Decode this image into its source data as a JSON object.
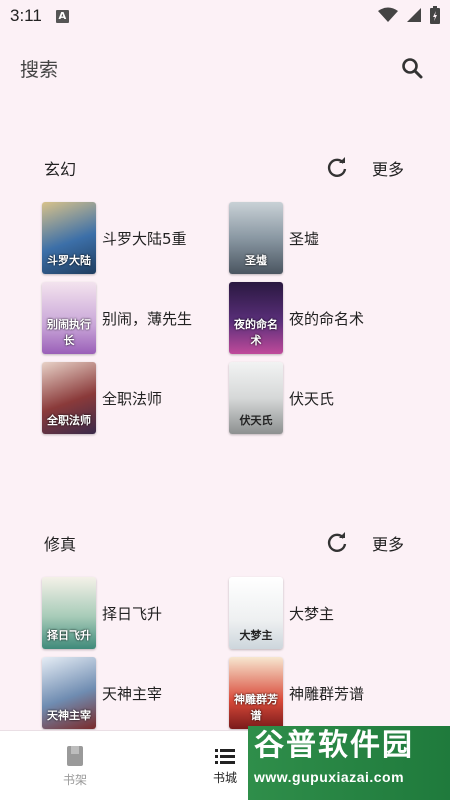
{
  "status_bar": {
    "time": "3:11",
    "notification_glyph": "A",
    "icons": [
      "wifi-icon",
      "signal-icon",
      "battery-icon"
    ]
  },
  "search": {
    "placeholder": "搜索",
    "icon": "search-icon"
  },
  "sections": [
    {
      "title": "玄幻",
      "more_label": "更多",
      "refresh_icon": "refresh-icon",
      "books": [
        {
          "title": "斗罗大陆5重",
          "cover_text": "斗罗大陆",
          "cover_color": "#3c6fa8"
        },
        {
          "title": "圣墟",
          "cover_text": "圣墟",
          "cover_color": "#8a98a3"
        },
        {
          "title": "别闹，薄先生",
          "cover_text": "别闹执行长",
          "cover_color": "#c9a6d8"
        },
        {
          "title": "夜的命名术",
          "cover_text": "夜的命名术",
          "cover_color": "#5a2f7a"
        },
        {
          "title": "全职法师",
          "cover_text": "全职法师",
          "cover_color": "#8a3a3a"
        },
        {
          "title": "伏天氏",
          "cover_text": "伏天氏",
          "cover_color": "#d6d8d8"
        }
      ]
    },
    {
      "title": "修真",
      "more_label": "更多",
      "refresh_icon": "refresh-icon",
      "books": [
        {
          "title": "择日飞升",
          "cover_text": "择日飞升",
          "cover_color": "#a7cbb8"
        },
        {
          "title": "大梦主",
          "cover_text": "大梦主",
          "cover_color": "#eef0f1"
        },
        {
          "title": "天神主宰",
          "cover_text": "天神主宰",
          "cover_color": "#6f8cb1"
        },
        {
          "title": "神雕群芳谱",
          "cover_text": "神雕群芳谱",
          "cover_color": "#d94a3a"
        }
      ]
    }
  ],
  "bottom_nav": [
    {
      "label": "书架",
      "icon": "book-icon",
      "active": false
    },
    {
      "label": "书城",
      "icon": "list-icon",
      "active": true
    }
  ],
  "watermark": {
    "title": "谷普软件园",
    "url": "www.gupuxiazai.com"
  },
  "colors": {
    "background": "#fcf1f6",
    "watermark_green": "#2f8e4a"
  }
}
